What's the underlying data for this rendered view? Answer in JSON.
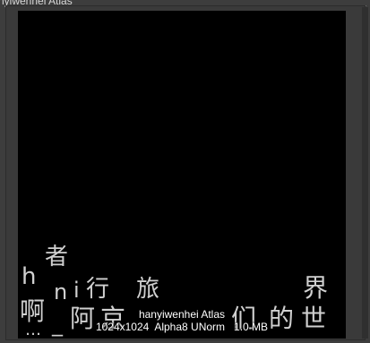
{
  "window": {
    "title": "nyiwenhei Atlas"
  },
  "preview": {
    "glyphs": {
      "zhe": "者",
      "h": "h",
      "n": "n",
      "i": "i",
      "xing": "行",
      "lv": "旅",
      "jie": "界",
      "a1": "啊",
      "dots": "…",
      "dash": "_",
      "a2": "阿",
      "jing": "京",
      "men": "们",
      "de": "的",
      "shi": "世"
    },
    "info_name": "hanyiwenhei Atlas",
    "info_details": "1024x1024  Alpha8 UNorm   1.0 MB"
  }
}
